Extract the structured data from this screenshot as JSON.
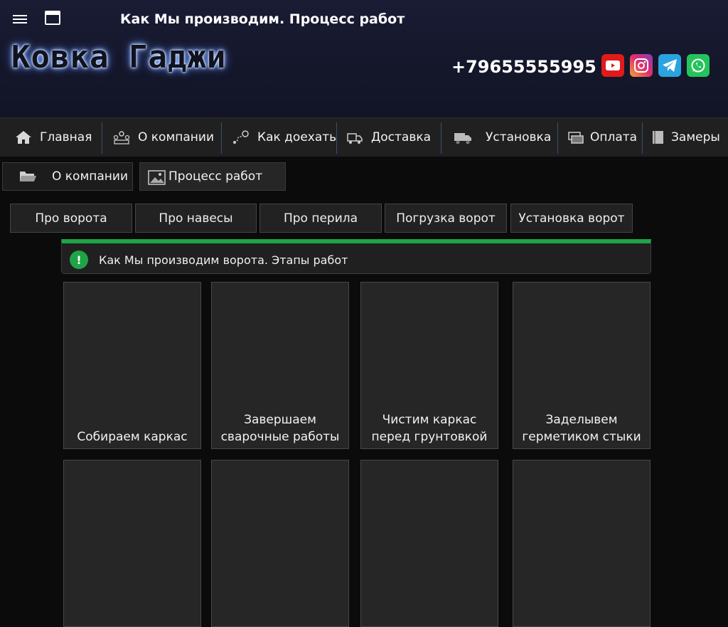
{
  "header": {
    "page_title": "Как Мы производим. Процесс работ",
    "logo_text": "Ковка Гаджи",
    "phone": "+79655555995",
    "socials": [
      "youtube-icon",
      "instagram-icon",
      "telegram-icon",
      "whatsapp-icon"
    ]
  },
  "nav": {
    "items": [
      {
        "label": "Главная",
        "icon": "home-icon"
      },
      {
        "label": "О компании",
        "icon": "team-icon"
      },
      {
        "label": "Как доехать",
        "icon": "route-icon"
      },
      {
        "label": "Доставка",
        "icon": "delivery-icon"
      },
      {
        "label": "Установка",
        "icon": "truck-icon"
      },
      {
        "label": "Оплата",
        "icon": "payment-icon"
      },
      {
        "label": "Замеры",
        "icon": "book-icon"
      }
    ]
  },
  "breadcrumb": {
    "items": [
      {
        "label": "О компании",
        "icon": "folder-icon"
      },
      {
        "label": "Процесс работ",
        "icon": "image-icon"
      }
    ]
  },
  "tabs": [
    "Про ворота",
    "Про навесы",
    "Про перила",
    "Погрузка ворот",
    "Установка ворот"
  ],
  "notice": {
    "text": "Как Мы производим ворота. Этапы работ",
    "icon_glyph": "!"
  },
  "cards": [
    {
      "line1": "",
      "line2": "Собираем каркас"
    },
    {
      "line1": "Завершаем",
      "line2": "сварочные работы"
    },
    {
      "line1": "Чистим каркас",
      "line2": "перед грунтовкой"
    },
    {
      "line1": "Заделывем",
      "line2": "герметиком стыки"
    },
    {
      "line1": "",
      "line2": ""
    },
    {
      "line1": "",
      "line2": ""
    },
    {
      "line1": "",
      "line2": ""
    },
    {
      "line1": "",
      "line2": ""
    }
  ],
  "colors": {
    "accent_green": "#1fa347",
    "header_bg": "#14162a",
    "nav_bg": "#202020"
  }
}
